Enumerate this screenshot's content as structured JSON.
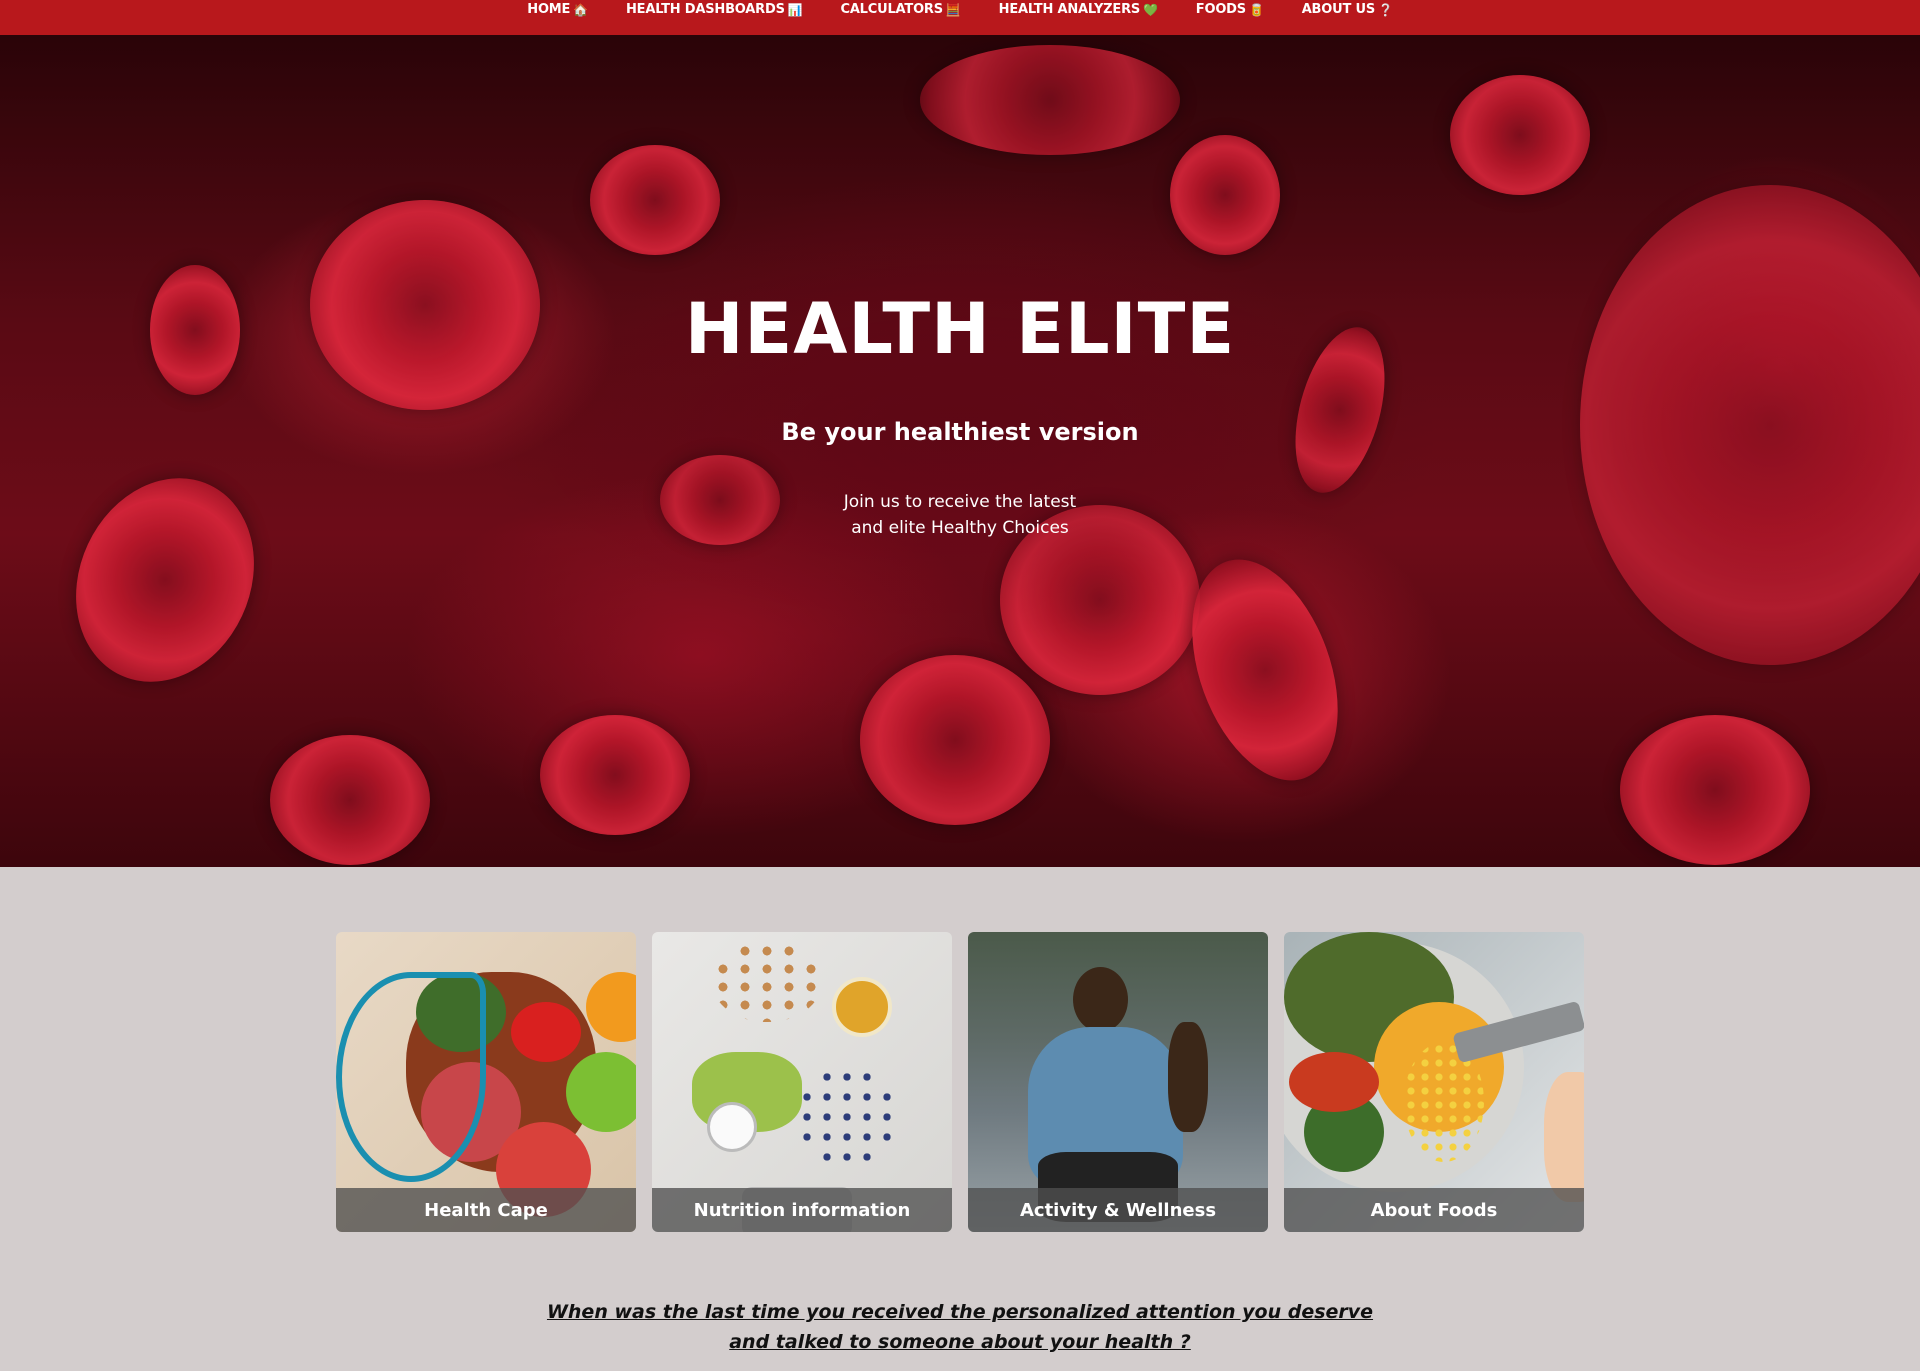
{
  "nav": {
    "items": [
      {
        "label": "HOME",
        "icon": "🏠"
      },
      {
        "label": "HEALTH DASHBOARDS",
        "icon": "📊"
      },
      {
        "label": "CALCULATORS",
        "icon": "🧮"
      },
      {
        "label": "HEALTH ANALYZERS",
        "icon": "💚"
      },
      {
        "label": "FOODS",
        "icon": "🥫"
      },
      {
        "label": "ABOUT US",
        "icon": "❔"
      }
    ]
  },
  "hero": {
    "title": "HEALTH ELITE",
    "subtitle": "Be your healthiest version",
    "text_line1": "Join us to receive the latest",
    "text_line2": "and elite Healthy Choices"
  },
  "cards": [
    {
      "label": "Health Cape"
    },
    {
      "label": "Nutrition information"
    },
    {
      "label": "Activity & Wellness"
    },
    {
      "label": "About Foods"
    }
  ],
  "question": {
    "line1": "When was the last time you received the personalized attention you deserve",
    "line2": "and talked to someone about your health ?"
  },
  "colors": {
    "nav_bg": "#b8181c",
    "page_bg": "#d3cdcd",
    "caption_bg": "#505050"
  }
}
